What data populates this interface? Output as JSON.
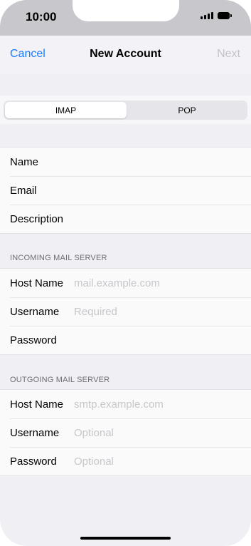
{
  "status_bar": {
    "time": "10:00",
    "icons": [
      "signal-icon",
      "battery-icon"
    ]
  },
  "nav": {
    "cancel_label": "Cancel",
    "title": "New Account",
    "next_label": "Next",
    "cancel_color": "#1a7cff",
    "next_disabled_color": "#c4c4c8"
  },
  "segments": {
    "options": [
      "IMAP",
      "POP"
    ],
    "selected": "IMAP"
  },
  "account": {
    "name_label": "Name",
    "email_label": "Email",
    "description_label": "Description"
  },
  "incoming": {
    "header": "INCOMING MAIL SERVER",
    "host_label": "Host Name",
    "host_placeholder": "mail.example.com",
    "username_label": "Username",
    "username_placeholder": "Required",
    "password_label": "Password"
  },
  "outgoing": {
    "header": "OUTGOING MAIL SERVER",
    "host_label": "Host Name",
    "host_placeholder": "smtp.example.com",
    "username_label": "Username",
    "username_placeholder": "Optional",
    "password_label": "Password",
    "password_placeholder": "Optional"
  }
}
